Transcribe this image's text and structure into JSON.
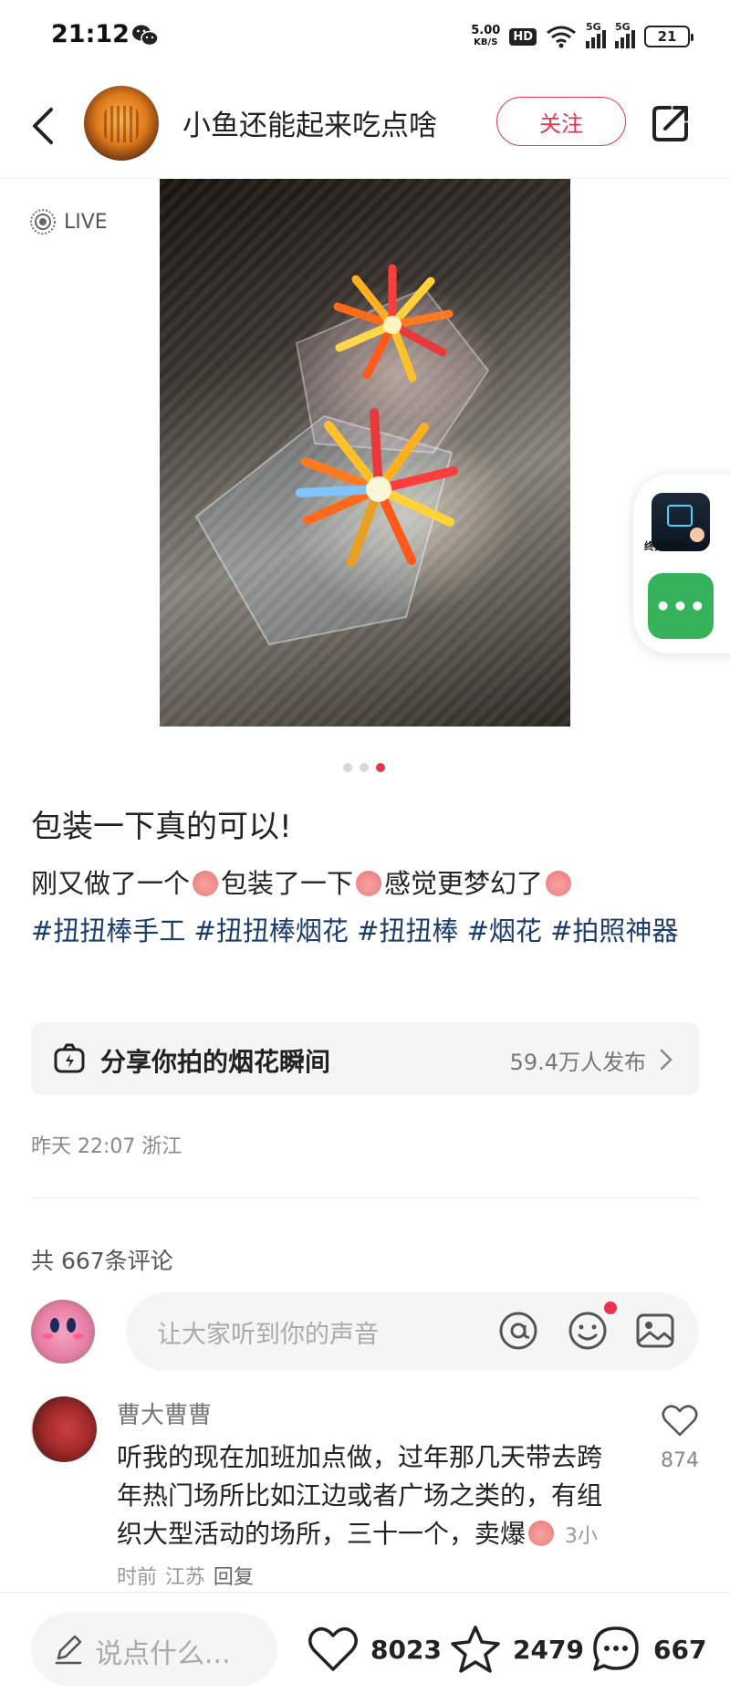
{
  "status_bar": {
    "time": "21:12",
    "speed_value": "5.00",
    "speed_unit": "KB/S",
    "hd": "HD",
    "net1": "5G",
    "net2": "5G",
    "battery": "21"
  },
  "header": {
    "author_name": "小鱼还能起来吃点啥",
    "follow_label": "关注"
  },
  "media": {
    "live_label": "LIVE",
    "page_count": 3,
    "active_page": 3
  },
  "side_widget": {
    "mini_app_label": "终身免费",
    "chat_label": "•••"
  },
  "post": {
    "title": "包装一下真的可以!",
    "body_1": "刚又做了一个",
    "body_2": "包装了一下",
    "body_3": "感觉更梦幻了",
    "hashtags": [
      "#扭扭棒手工",
      "#扭扭棒烟花",
      "#扭扭棒",
      "#烟花",
      "#拍照神器"
    ],
    "topic_label": "分享你拍的烟花瞬间",
    "topic_count": "59.4万人发布",
    "meta": "昨天 22:07 浙江"
  },
  "comments": {
    "total_label": "共 667条评论",
    "input_placeholder": "让大家听到你的声音",
    "items": [
      {
        "author": "曹大曹曹",
        "text": "听我的现在加班加点做，过年那几天带去跨年热门场所比如江边或者广场之类的，有组织大型活动的场所，三十一个，卖爆",
        "time": "3小时前",
        "location": "江苏",
        "reply": "回复",
        "likes": "874"
      }
    ]
  },
  "bottom_bar": {
    "input_placeholder": "说点什么...",
    "likes": "8023",
    "favorites": "2479",
    "comments": "667"
  },
  "colors": {
    "accent": "#e8334a",
    "hashtag": "#1a3d6d",
    "chat_green": "#36b35a"
  }
}
